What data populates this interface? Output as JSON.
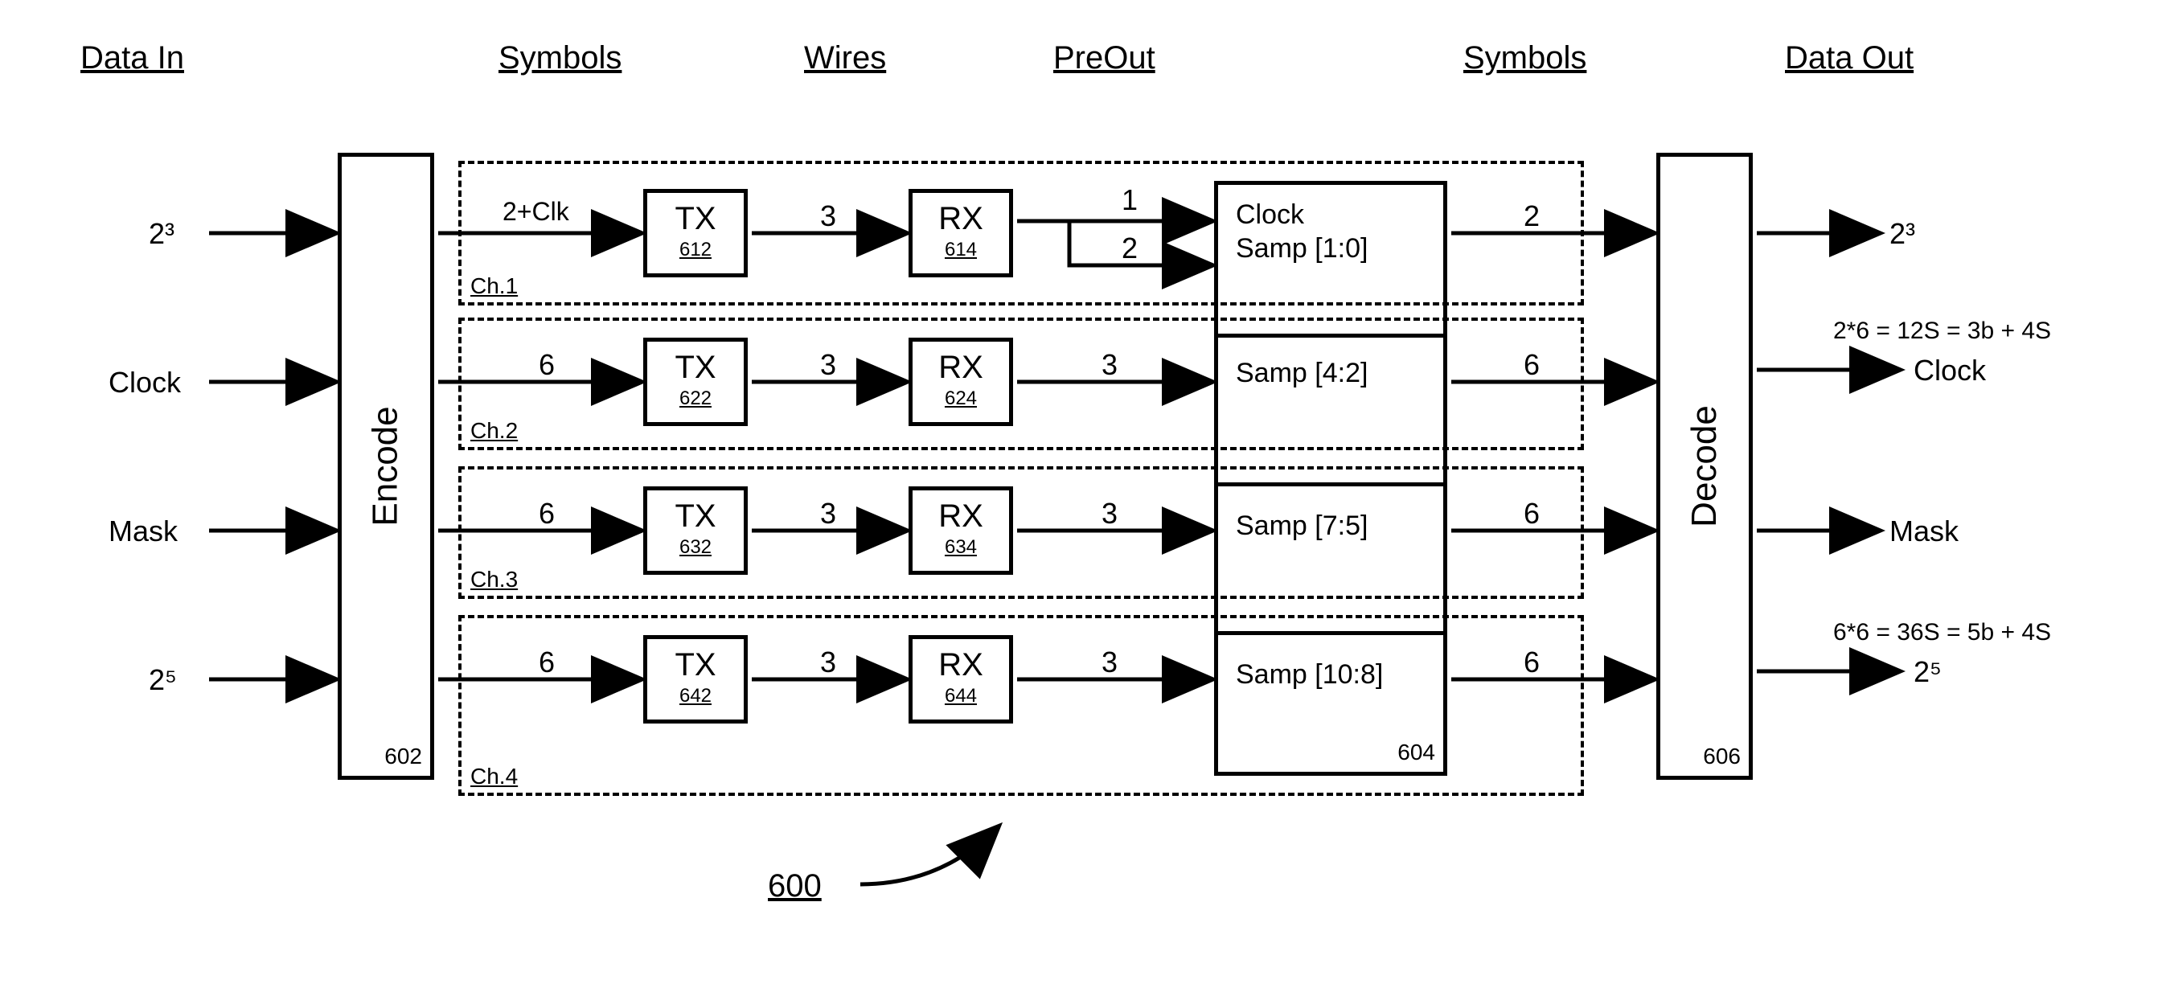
{
  "headers": {
    "dataIn": "Data In",
    "symbols1": "Symbols",
    "wires": "Wires",
    "preOut": "PreOut",
    "symbols2": "Symbols",
    "dataOut": "Data Out"
  },
  "encode": {
    "label": "Encode",
    "num": "602"
  },
  "decode": {
    "label": "Decode",
    "num": "606"
  },
  "ch1": {
    "chLabel": "Ch.1",
    "symIn": "2+Clk",
    "tx": {
      "lbl": "TX",
      "num": "612"
    },
    "wires": "3",
    "rx": {
      "lbl": "RX",
      "num": "614"
    },
    "pre1": "1",
    "pre2": "2",
    "sampTop": "Clock",
    "sampBot": "Samp [1:0]",
    "symOut": "2"
  },
  "ch2": {
    "chLabel": "Ch.2",
    "symIn": "6",
    "tx": {
      "lbl": "TX",
      "num": "622"
    },
    "wires": "3",
    "rx": {
      "lbl": "RX",
      "num": "624"
    },
    "pre": "3",
    "samp": "Samp [4:2]",
    "symOut": "6"
  },
  "ch3": {
    "chLabel": "Ch.3",
    "symIn": "6",
    "tx": {
      "lbl": "TX",
      "num": "632"
    },
    "wires": "3",
    "rx": {
      "lbl": "RX",
      "num": "634"
    },
    "pre": "3",
    "samp": "Samp [7:5]",
    "symOut": "6"
  },
  "ch4": {
    "chLabel": "Ch.4",
    "symIn": "6",
    "tx": {
      "lbl": "TX",
      "num": "642"
    },
    "wires": "3",
    "rx": {
      "lbl": "RX",
      "num": "644"
    },
    "pre": "3",
    "samp": "Samp [10:8]",
    "symOut": "6"
  },
  "sampNum": "604",
  "inputs": {
    "i1": "2³",
    "i2": "Clock",
    "i3": "Mask",
    "i4": "2⁵"
  },
  "outputs": {
    "o1": "2³",
    "o2a": "2*6 = 12S = 3b + 4S",
    "o2b": "Clock",
    "o3": "Mask",
    "o4a": "6*6 = 36S = 5b + 4S",
    "o4b": "2⁵"
  },
  "figNum": "600"
}
